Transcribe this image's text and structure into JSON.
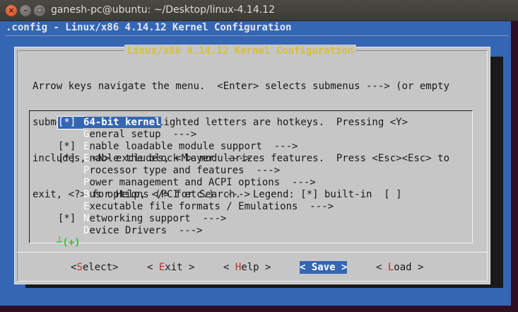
{
  "window": {
    "title": "ganesh-pc@ubuntu: ~/Desktop/linux-4.14.12",
    "close_glyph": "×",
    "minimize_glyph": "–",
    "maximize_glyph": "□"
  },
  "terminal": {
    "header": ".config - Linux/x86 4.14.12 Kernel Configuration",
    "colors": {
      "background": "#3466b3",
      "dialog": "#c6c6c6",
      "title": "#d6c03a",
      "hotkey": "#c0302c"
    }
  },
  "dialog": {
    "title": "Linux/x86 4.14.12 Kernel Configuration",
    "help_lines": [
      "Arrow keys navigate the menu.  <Enter> selects submenus ---> (or empty",
      "submenus ----).  Highlighted letters are hotkeys.  Pressing <Y>",
      "includes, <N> excludes, <M> modularizes features.  Press <Esc><Esc> to",
      "exit, <?> for Help, </> for Search.  Legend: [*] built-in  [ ]"
    ]
  },
  "menu": {
    "items": [
      {
        "mark": "[*]",
        "hot": "6",
        "rest": "4-bit kernel"
      },
      {
        "mark": "",
        "hot": "G",
        "rest": "eneral setup  --->"
      },
      {
        "mark": "[*]",
        "hot": "E",
        "rest": "nable loadable module support  --->"
      },
      {
        "mark": "[*]",
        "hot": "E",
        "rest": "nable the block layer  --->"
      },
      {
        "mark": "",
        "hot": "P",
        "rest": "rocessor type and features  --->"
      },
      {
        "mark": "",
        "hot": "P",
        "rest": "ower management and ACPI options  --->"
      },
      {
        "mark": "",
        "hot": "B",
        "rest": "us options (PCI etc.)  --->"
      },
      {
        "mark": "",
        "hot": "E",
        "rest": "xecutable file formats / Emulations  --->"
      },
      {
        "mark": "[*]",
        "hot": "N",
        "rest": "etworking support  --->"
      },
      {
        "mark": "",
        "hot": "D",
        "rest": "evice Drivers  --->"
      }
    ],
    "more_indicator": "┴(+)"
  },
  "buttons": [
    {
      "pre": "<",
      "hot": "S",
      "post": "elect>"
    },
    {
      "pre": "< ",
      "hot": "E",
      "post": "xit >"
    },
    {
      "pre": "< ",
      "hot": "H",
      "post": "elp >"
    },
    {
      "pre": "< ",
      "hot": "S",
      "post": "ave >"
    },
    {
      "pre": "< ",
      "hot": "L",
      "post": "oad >"
    }
  ]
}
